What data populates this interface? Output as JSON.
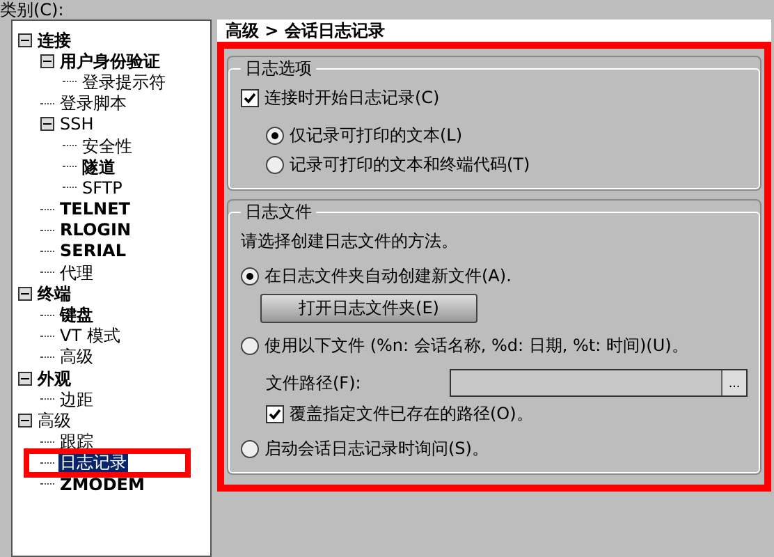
{
  "category_label": "类别(C):",
  "tree": [
    {
      "label": "连接",
      "bold": true,
      "expanded": true,
      "selected": false,
      "children": [
        {
          "label": "用户身份验证",
          "bold": true,
          "expanded": true,
          "selected": false,
          "children": [
            {
              "label": "登录提示符",
              "bold": false,
              "selected": false
            }
          ]
        },
        {
          "label": "登录脚本",
          "bold": false,
          "selected": false
        },
        {
          "label": "SSH",
          "bold": false,
          "expanded": true,
          "selected": false,
          "children": [
            {
              "label": "安全性",
              "bold": false,
              "selected": false
            },
            {
              "label": "隧道",
              "bold": true,
              "selected": false
            },
            {
              "label": "SFTP",
              "bold": false,
              "selected": false
            }
          ]
        },
        {
          "label": "TELNET",
          "bold": true,
          "selected": false
        },
        {
          "label": "RLOGIN",
          "bold": true,
          "selected": false
        },
        {
          "label": "SERIAL",
          "bold": true,
          "selected": false
        },
        {
          "label": "代理",
          "bold": false,
          "selected": false
        }
      ]
    },
    {
      "label": "终端",
      "bold": true,
      "expanded": true,
      "selected": false,
      "children": [
        {
          "label": "键盘",
          "bold": true,
          "selected": false
        },
        {
          "label": "VT 模式",
          "bold": false,
          "selected": false
        },
        {
          "label": "高级",
          "bold": false,
          "selected": false
        }
      ]
    },
    {
      "label": "外观",
      "bold": true,
      "expanded": true,
      "selected": false,
      "children": [
        {
          "label": "边距",
          "bold": false,
          "selected": false
        }
      ]
    },
    {
      "label": "高级",
      "bold": false,
      "expanded": true,
      "selected": false,
      "children": [
        {
          "label": "跟踪",
          "bold": false,
          "selected": false
        },
        {
          "label": "日志记录",
          "bold": false,
          "selected": true,
          "highlighted": true
        },
        {
          "label": "ZMODEM",
          "bold": true,
          "selected": false
        }
      ]
    }
  ],
  "breadcrumb": "高级 > 会话日志记录",
  "panel": {
    "highlighted": true
  },
  "log_options": {
    "title": "日志选项",
    "start_on_connect": {
      "label": "连接时开始日志记录(C)",
      "checked": true
    },
    "modes": [
      {
        "label": "仅记录可打印的文本(L)",
        "selected": true
      },
      {
        "label": "记录可打印的文本和终端代码(T)",
        "selected": false
      }
    ]
  },
  "log_file": {
    "title": "日志文件",
    "prompt": "请选择创建日志文件的方法。",
    "methods": [
      {
        "label": "在日志文件夹自动创建新文件(A).",
        "selected": true,
        "button": "打开日志文件夹(E)"
      },
      {
        "label": "使用以下文件 (%n: 会话名称, %d: 日期, %t: 时间)(U)。",
        "selected": false,
        "path_label": "文件路径(F):",
        "browse": "...",
        "overwrite": {
          "label": "覆盖指定文件已存在的路径(O)。",
          "checked": true
        }
      },
      {
        "label": "启动会话日志记录时询问(S)。",
        "selected": false
      }
    ]
  }
}
